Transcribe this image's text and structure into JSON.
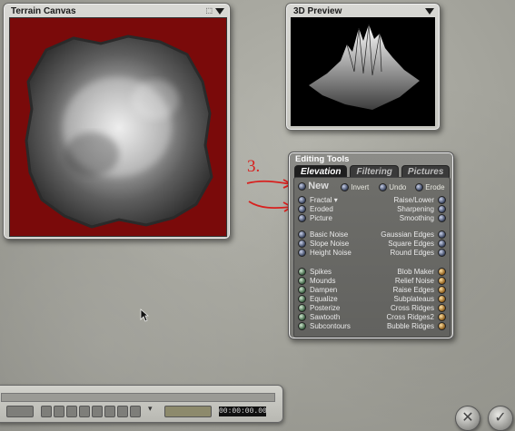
{
  "terrain_canvas": {
    "title": "Terrain Canvas"
  },
  "preview": {
    "title": "3D Preview"
  },
  "annotation": {
    "number": "3."
  },
  "editing_tools": {
    "title": "Editing Tools",
    "tabs": [
      "Elevation",
      "Filtering",
      "Pictures"
    ],
    "new_row": {
      "new": "New",
      "invert": "Invert",
      "undo": "Undo",
      "erode": "Erode"
    },
    "left_group1": [
      "Fractal",
      "Eroded",
      "Picture"
    ],
    "right_group1": [
      "Raise/Lower",
      "Sharpening",
      "Smoothing"
    ],
    "left_group2": [
      "Basic Noise",
      "Slope Noise",
      "Height Noise"
    ],
    "right_group2": [
      "Gaussian Edges",
      "Square Edges",
      "Round Edges"
    ],
    "left_group3": [
      "Spikes",
      "Mounds",
      "Dampen",
      "Equalize",
      "Posterize",
      "Sawtooth",
      "Subcontours"
    ],
    "right_group3": [
      "Blob Maker",
      "Relief Noise",
      "Raise Edges",
      "Subplateaus",
      "Cross Ridges",
      "Cross Ridges2",
      "Bubble Ridges"
    ]
  },
  "timeline": {
    "time": "00:00:00.00"
  },
  "buttons": {
    "cancel_icon": "x-icon",
    "ok_icon": "check-icon"
  }
}
